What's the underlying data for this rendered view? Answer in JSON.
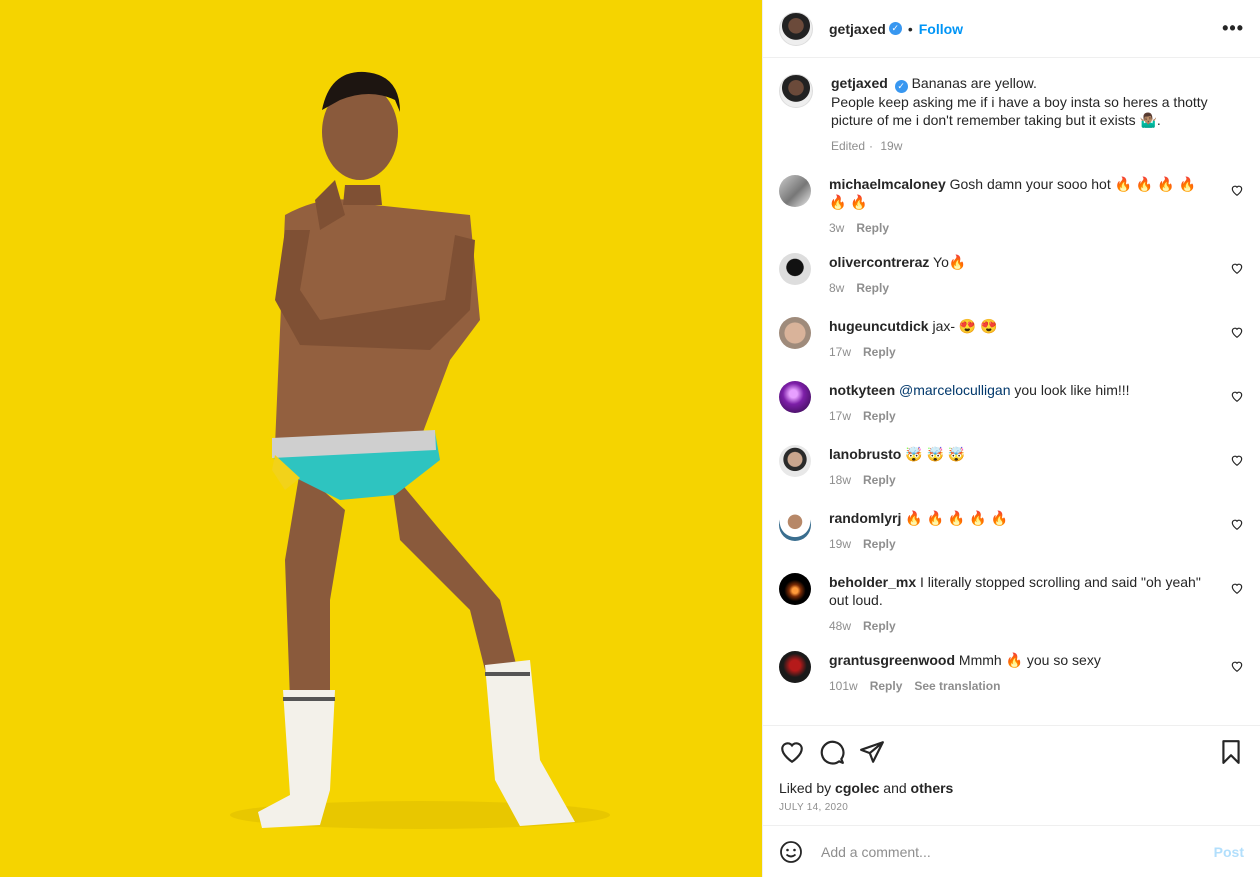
{
  "header": {
    "username": "getjaxed",
    "follow_label": "Follow",
    "more_label": "•••"
  },
  "caption": {
    "username": "getjaxed",
    "line1": "Bananas are yellow.",
    "line2": "People keep asking me if i have a boy insta so heres a thotty picture of me i don't remember taking but it exists 🤷🏽‍♂️.",
    "edited": "Edited",
    "time": "19w"
  },
  "comments": [
    {
      "username": "michaelmcaloney",
      "text": "Gosh damn your sooo hot 🔥 🔥 🔥 🔥 🔥 🔥",
      "time": "3w",
      "reply": "Reply"
    },
    {
      "username": "olivercontreraz",
      "text": "Yo🔥",
      "time": "8w",
      "reply": "Reply"
    },
    {
      "username": "hugeuncutdick",
      "text": "jax- 😍 😍",
      "time": "17w",
      "reply": "Reply"
    },
    {
      "username": "notkyteen",
      "mention": "@marceloculligan",
      "text": "you look like him!!!",
      "time": "17w",
      "reply": "Reply"
    },
    {
      "username": "lanobrusto",
      "text": "🤯 🤯 🤯",
      "time": "18w",
      "reply": "Reply"
    },
    {
      "username": "randomlyrj",
      "text": "🔥 🔥 🔥 🔥 🔥",
      "time": "19w",
      "reply": "Reply"
    },
    {
      "username": "beholder_mx",
      "text": "I literally stopped scrolling and said \"oh yeah\" out loud.",
      "time": "48w",
      "reply": "Reply"
    },
    {
      "username": "grantusgreenwood",
      "text": "Mmmh 🔥 you so sexy",
      "time": "101w",
      "reply": "Reply",
      "translate": "See translation"
    }
  ],
  "likes": {
    "prefix": "Liked by",
    "user": "cgolec",
    "and": "and",
    "others": "others"
  },
  "date": "JULY 14, 2020",
  "add_comment": {
    "placeholder": "Add a comment...",
    "post_label": "Post"
  },
  "colors": {
    "accent": "#0095f6",
    "photo_bg": "#f5d400",
    "post_disabled": "#b2dffc"
  }
}
